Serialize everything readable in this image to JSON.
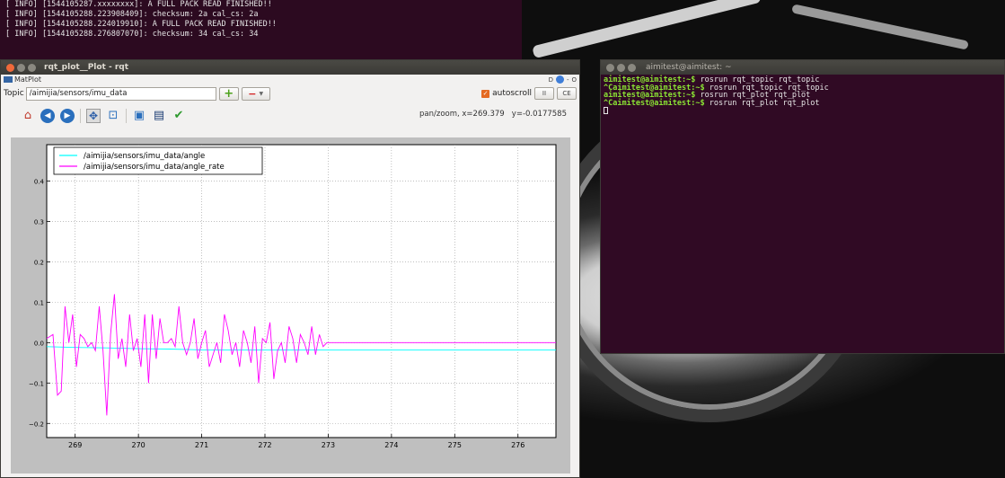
{
  "colors": {
    "terminal_bg": "#300a24",
    "prompt_green": "#8ae234",
    "series_angle": "#00ffff",
    "series_angle_rate": "#ff00ff",
    "close_button": "#f0693a",
    "autoscroll_check": "#e46a22"
  },
  "back_terminal": {
    "lines": [
      "[ INFO] [1544105287.xxxxxxxx]: A FULL PACK READ FINISHED!!",
      "",
      "[ INFO] [1544105288.223908409]: checksum: 2a cal_cs: 2a",
      "[ INFO] [1544105288.224019910]: A FULL PACK READ FINISHED!!",
      "",
      "[ INFO] [1544105288.276807070]: checksum: 34 cal_cs: 34"
    ]
  },
  "rqt_window": {
    "title": "rqt_plot__Plot - rqt",
    "plugin_name": "MatPlot",
    "plugin_controls": "D",
    "plugin_minimize": "-",
    "plugin_close": "O",
    "topic_label": "Topic",
    "topic_value": "/aimijia/sensors/imu_data",
    "autoscroll_label": "autoscroll",
    "pause_label": "II",
    "clear_label": "CE",
    "coords_text": "pan/zoom, x=269.379   y=-0.0177585",
    "toolbar_icons": [
      "home-icon",
      "back-icon",
      "forward-icon",
      "pan-icon",
      "zoom-icon",
      "subplots-icon",
      "save-icon",
      "edit-curves-icon"
    ]
  },
  "right_terminal": {
    "title": "aimitest@aimitest: ~",
    "lines": [
      {
        "prompt": "aimitest@aimitest:~$",
        "cmd": " rosrun rqt_topic rqt_topic"
      },
      {
        "prompt": "^Caimitest@aimitest:~$",
        "cmd": " rosrun rqt_topic rqt_topic"
      },
      {
        "prompt": "aimitest@aimitest:~$",
        "cmd": " rosrun rqt_plot rqt_plot"
      },
      {
        "prompt": "^Caimitest@aimitest:~$",
        "cmd": " rosrun rqt_plot rqt_plot"
      }
    ]
  },
  "chart_data": {
    "type": "line",
    "title": "",
    "xlabel": "",
    "ylabel": "",
    "xlim": [
      268.55,
      276.6
    ],
    "ylim": [
      -0.235,
      0.49
    ],
    "xticks": [
      269,
      270,
      271,
      272,
      273,
      274,
      275,
      276
    ],
    "yticks": [
      -0.2,
      -0.1,
      0.0,
      0.1,
      0.2,
      0.3,
      0.4
    ],
    "ytick_labels": [
      "−0.2",
      "−0.1",
      "0.0",
      "0.1",
      "0.2",
      "0.3",
      "0.4"
    ],
    "grid": true,
    "legend": "top-left",
    "series": [
      {
        "name": "/aimijia/sensors/imu_data/angle",
        "color": "#00ffff",
        "x": [
          268.55,
          269.0,
          269.5,
          270.0,
          270.5,
          271.0,
          271.5,
          272.0,
          272.5,
          273.0,
          274.0,
          275.0,
          276.0,
          276.6
        ],
        "y": [
          -0.01,
          -0.012,
          -0.013,
          -0.015,
          -0.016,
          -0.018,
          -0.018,
          -0.018,
          -0.018,
          -0.018,
          -0.018,
          -0.018,
          -0.018,
          -0.018
        ]
      },
      {
        "name": "/aimijia/sensors/imu_data/angle_rate",
        "color": "#ff00ff",
        "x": [
          268.55,
          268.65,
          268.72,
          268.78,
          268.84,
          268.9,
          268.96,
          269.02,
          269.08,
          269.14,
          269.2,
          269.26,
          269.32,
          269.38,
          269.44,
          269.5,
          269.56,
          269.62,
          269.68,
          269.74,
          269.8,
          269.86,
          269.92,
          269.98,
          270.04,
          270.1,
          270.16,
          270.22,
          270.28,
          270.34,
          270.4,
          270.46,
          270.52,
          270.58,
          270.64,
          270.7,
          270.76,
          270.82,
          270.88,
          270.94,
          271.0,
          271.06,
          271.12,
          271.18,
          271.24,
          271.3,
          271.36,
          271.42,
          271.48,
          271.54,
          271.6,
          271.66,
          271.72,
          271.78,
          271.84,
          271.9,
          271.96,
          272.02,
          272.08,
          272.14,
          272.2,
          272.26,
          272.32,
          272.38,
          272.44,
          272.5,
          272.56,
          272.62,
          272.68,
          272.74,
          272.8,
          272.86,
          272.92,
          272.98,
          273.05,
          274.0,
          275.0,
          276.0,
          276.6
        ],
        "y": [
          0.01,
          0.02,
          -0.13,
          -0.12,
          0.09,
          0.0,
          0.07,
          -0.06,
          0.02,
          0.01,
          -0.01,
          0.0,
          -0.02,
          0.09,
          -0.02,
          -0.18,
          0.02,
          0.12,
          -0.04,
          0.01,
          -0.06,
          0.07,
          -0.02,
          0.01,
          -0.06,
          0.07,
          -0.1,
          0.07,
          -0.04,
          0.06,
          0.0,
          0.0,
          0.01,
          -0.01,
          0.09,
          0.0,
          -0.03,
          0.0,
          0.06,
          -0.04,
          0.0,
          0.03,
          -0.06,
          -0.03,
          0.0,
          -0.05,
          0.07,
          0.03,
          -0.03,
          0.0,
          -0.06,
          0.03,
          0.0,
          -0.05,
          0.04,
          -0.1,
          0.01,
          0.0,
          0.05,
          -0.09,
          -0.02,
          0.0,
          -0.05,
          0.04,
          0.01,
          -0.05,
          0.02,
          0.0,
          -0.03,
          0.04,
          -0.03,
          0.02,
          -0.01,
          0.0,
          0.0,
          0.0,
          0.0,
          0.0,
          0.0
        ]
      }
    ]
  }
}
